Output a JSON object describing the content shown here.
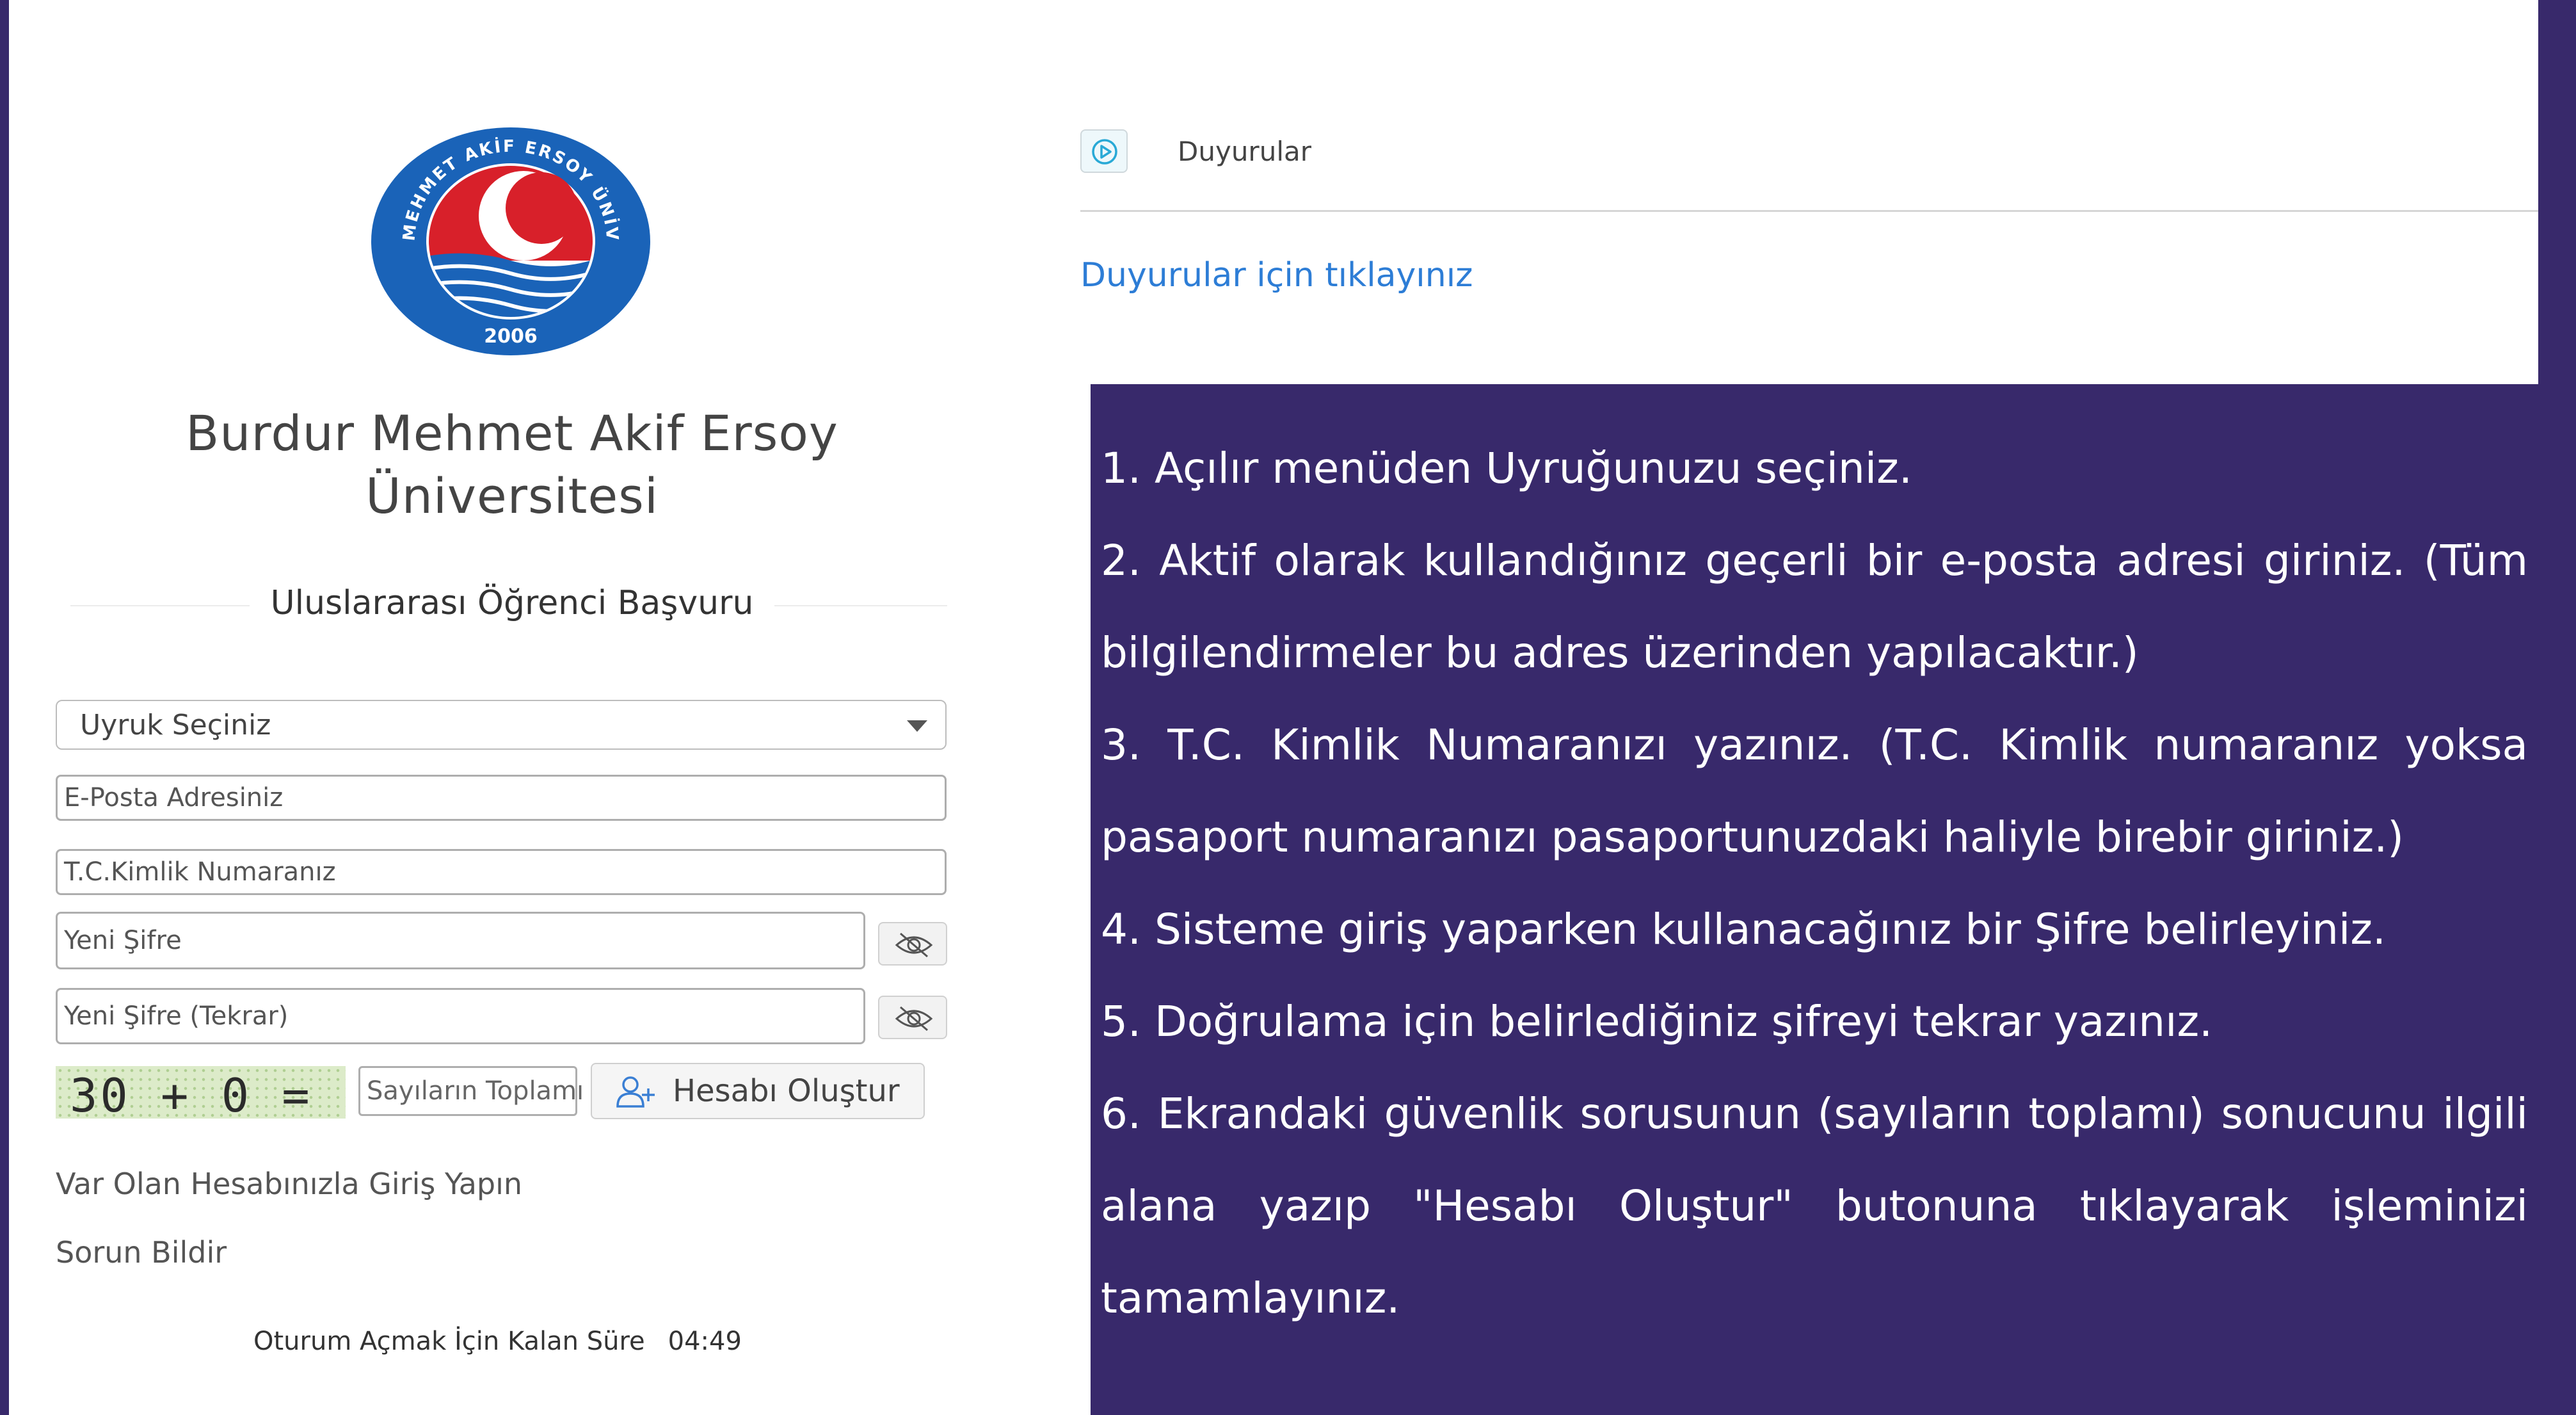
{
  "university": {
    "name": "Burdur Mehmet Akif Ersoy Üniversitesi",
    "logo_top_text": "MEHMET AKİF ERSOY ÜNİVERSİTESİ",
    "logo_year": "2006"
  },
  "form": {
    "section_title": "Uluslararası Öğrenci Başvuru",
    "nationality_select": {
      "value": "Uyruk Seçiniz"
    },
    "email": {
      "placeholder": "E-Posta Adresiniz"
    },
    "tc_number": {
      "placeholder": "T.C.Kimlik Numaranız"
    },
    "new_password": {
      "placeholder": "Yeni Şifre"
    },
    "new_password_repeat": {
      "placeholder": "Yeni Şifre (Tekrar)"
    },
    "captcha_text": "30 + 0 = ?",
    "sum_input": {
      "placeholder": "Sayıların Toplamı"
    },
    "create_button_label": "Hesabı Oluştur"
  },
  "links": {
    "login": "Var Olan Hesabınızla Giriş Yapın",
    "report": "Sorun Bildir"
  },
  "session": {
    "label": "Oturum Açmak İçin Kalan Süre",
    "time": "04:49"
  },
  "announcements": {
    "title": "Duyurular",
    "link_text": "Duyurular için tıklayınız"
  },
  "instructions": [
    "1. Açılır menüden Uyruğunuzu seçiniz.",
    "2. Aktif olarak kullandığınız geçerli bir e-posta adresi giriniz. (Tüm bilgilendirmeler bu adres üzerinden yapılacaktır.)",
    "3. T.C. Kimlik Numaranızı yazınız. (T.C. Kimlik numaranız yoksa pasaport numaranızı pasaportunuzdaki haliyle birebir  giriniz.)",
    "4. Sisteme giriş yaparken kullanacağınız bir Şifre belirleyiniz.",
    "5. Doğrulama için belirlediğiniz şifreyi tekrar yazınız.",
    "6. Ekrandaki güvenlik sorusunun (sayıların toplamı) sonucunu ilgili alana yazıp \"Hesabı Oluştur\" butonuna tıklayarak işleminizi tamamlayınız."
  ],
  "colors": {
    "panel": "#38296b",
    "link": "#2d7dd6",
    "logo_blue": "#1a63b8",
    "logo_red": "#d8202a"
  }
}
